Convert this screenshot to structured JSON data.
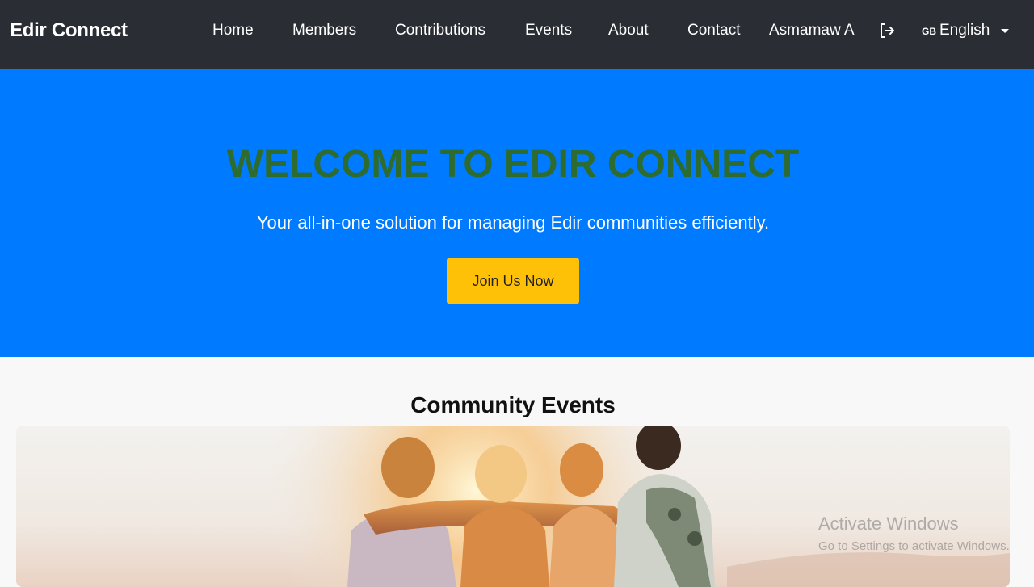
{
  "navbar": {
    "brand": "Edir Connect",
    "links": [
      "Home",
      "Members",
      "Contributions",
      "Events",
      "About",
      "Contact"
    ],
    "user_name": "Asmamaw A",
    "language": {
      "flag": "GB",
      "label": "English"
    },
    "icons": {
      "logout": "logout-icon",
      "caret": "chevron-down-icon"
    },
    "colors": {
      "background": "#2a2d33"
    }
  },
  "hero": {
    "title": "WELCOME TO EDIR CONNECT",
    "subtitle": "Your all-in-one solution for managing Edir communities efficiently.",
    "cta_label": "Join Us Now",
    "colors": {
      "background": "#007bff",
      "title": "#2e6b2e",
      "cta": "#ffc107"
    }
  },
  "events": {
    "heading": "Community Events",
    "image": "friends-embracing-sunset-photo"
  },
  "watermark": {
    "line1": "Activate Windows",
    "line2": "Go to Settings to activate Windows."
  }
}
